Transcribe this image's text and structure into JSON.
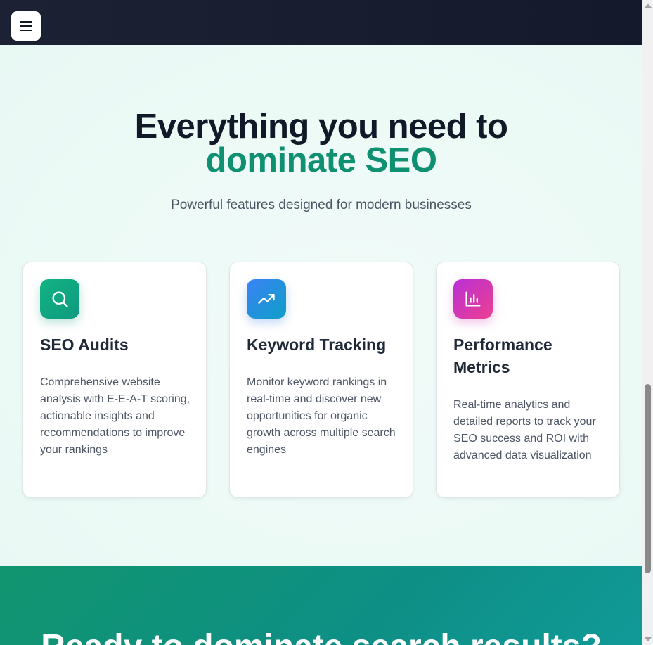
{
  "header": {
    "menu_icon": "hamburger-menu-icon"
  },
  "features": {
    "title_line1": "Everything you need to",
    "title_line2": "dominate SEO",
    "subtitle": "Powerful features designed for modern businesses",
    "cards": [
      {
        "icon": "search-icon",
        "title": "SEO Audits",
        "description": "Comprehensive website analysis with E-E-A-T scoring, actionable insights and recommendations to improve your rankings",
        "accent_from": "#10b981",
        "accent_to": "#0e9f86"
      },
      {
        "icon": "trending-up-icon",
        "title": "Keyword Tracking",
        "description": "Monitor keyword rankings in real-time and discover new opportunities for organic growth across multiple search engines",
        "accent_from": "#3b82f6",
        "accent_to": "#0ea5c9"
      },
      {
        "icon": "bar-chart-icon",
        "title": "Performance Metrics",
        "description": "Real-time analytics and detailed reports to track your SEO success and ROI with advanced data visualization",
        "accent_from": "#c026d3",
        "accent_to": "#ec4899"
      }
    ]
  },
  "cta": {
    "heading": "Ready to dominate search results?"
  },
  "colors": {
    "accent_green": "#0f9070",
    "heading_dark": "#111827",
    "topbar": "#1c2234"
  }
}
